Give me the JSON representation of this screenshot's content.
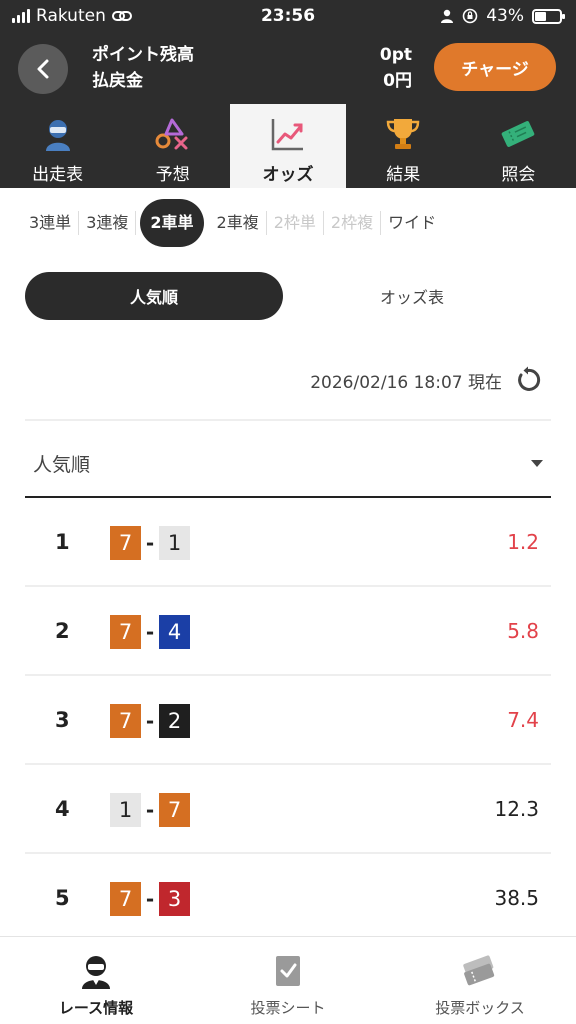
{
  "status_bar": {
    "carrier": "Rakuten",
    "time": "23:56",
    "battery": "43%",
    "battery_level": 0.43
  },
  "header": {
    "points_label": "ポイント残高",
    "refund_label": "払戻金",
    "points_value": "0pt",
    "refund_value": "0円",
    "charge_button": "チャージ"
  },
  "tabs": [
    {
      "label": "出走表",
      "icon": "racer-icon",
      "active": false
    },
    {
      "label": "予想",
      "icon": "prediction-icon",
      "active": false
    },
    {
      "label": "オッズ",
      "icon": "odds-chart-icon",
      "active": true
    },
    {
      "label": "結果",
      "icon": "trophy-icon",
      "active": false
    },
    {
      "label": "照会",
      "icon": "ticket-icon",
      "active": false
    }
  ],
  "bet_types": [
    {
      "label": "3連単",
      "state": "normal"
    },
    {
      "label": "3連複",
      "state": "normal"
    },
    {
      "label": "2車単",
      "state": "active"
    },
    {
      "label": "2車複",
      "state": "normal"
    },
    {
      "label": "2枠単",
      "state": "disabled"
    },
    {
      "label": "2枠複",
      "state": "disabled"
    },
    {
      "label": "ワイド",
      "state": "normal"
    }
  ],
  "view_toggle": {
    "popularity": "人気順",
    "odds_table": "オッズ表"
  },
  "updated_text": "2026/02/16 18:07 現在",
  "sort_select": {
    "value": "人気順"
  },
  "odds_rows": [
    {
      "rank": "1",
      "first": "7",
      "second": "1",
      "odds": "1.2",
      "highlight": true
    },
    {
      "rank": "2",
      "first": "7",
      "second": "4",
      "odds": "5.8",
      "highlight": true
    },
    {
      "rank": "3",
      "first": "7",
      "second": "2",
      "odds": "7.4",
      "highlight": true
    },
    {
      "rank": "4",
      "first": "1",
      "second": "7",
      "odds": "12.3",
      "highlight": false
    },
    {
      "rank": "5",
      "first": "7",
      "second": "3",
      "odds": "38.5",
      "highlight": false
    }
  ],
  "car_colors": {
    "1": {
      "bg": "#e6e6e6",
      "fg": "#222222"
    },
    "2": {
      "bg": "#1f1f1f",
      "fg": "#ffffff"
    },
    "3": {
      "bg": "#c0272d",
      "fg": "#ffffff"
    },
    "4": {
      "bg": "#1b3fa6",
      "fg": "#ffffff"
    },
    "7": {
      "bg": "#d56f22",
      "fg": "#ffffff"
    }
  },
  "colors": {
    "accent": "#e0792b",
    "dark": "#2d2d2d",
    "odds_highlight": "#e2424a"
  },
  "bottom_nav": [
    {
      "label": "レース情報",
      "icon": "racer-icon",
      "active": true
    },
    {
      "label": "投票シート",
      "icon": "checklist-icon",
      "active": false
    },
    {
      "label": "投票ボックス",
      "icon": "tickets-icon",
      "active": false
    }
  ]
}
